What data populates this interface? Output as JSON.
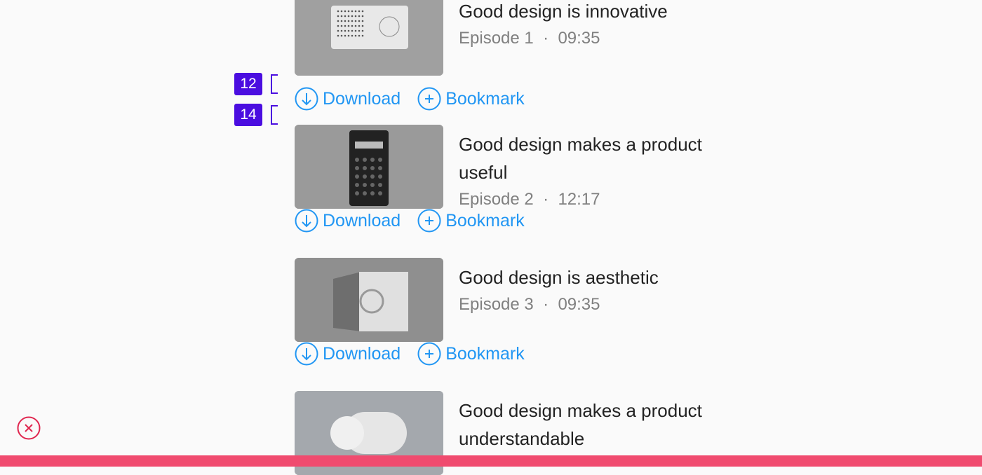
{
  "episodes": [
    {
      "title": "Good design is innovative",
      "episode": "Episode 1",
      "duration": "09:35",
      "download": "Download",
      "bookmark": "Bookmark"
    },
    {
      "title": "Good design makes a product useful",
      "episode": "Episode 2",
      "duration": "12:17",
      "download": "Download",
      "bookmark": "Bookmark"
    },
    {
      "title": "Good design is aesthetic",
      "episode": "Episode 3",
      "duration": "09:35",
      "download": "Download",
      "bookmark": "Bookmark"
    },
    {
      "title": "Good design makes a product understandable",
      "episode": "",
      "duration": "",
      "download": "",
      "bookmark": ""
    }
  ],
  "separator": "·",
  "badges": [
    "12",
    "14"
  ],
  "colors": {
    "accent": "#2196f3",
    "badge": "#4a0de0",
    "close": "#e0264f",
    "bottom_bar": "#f04b6f"
  }
}
